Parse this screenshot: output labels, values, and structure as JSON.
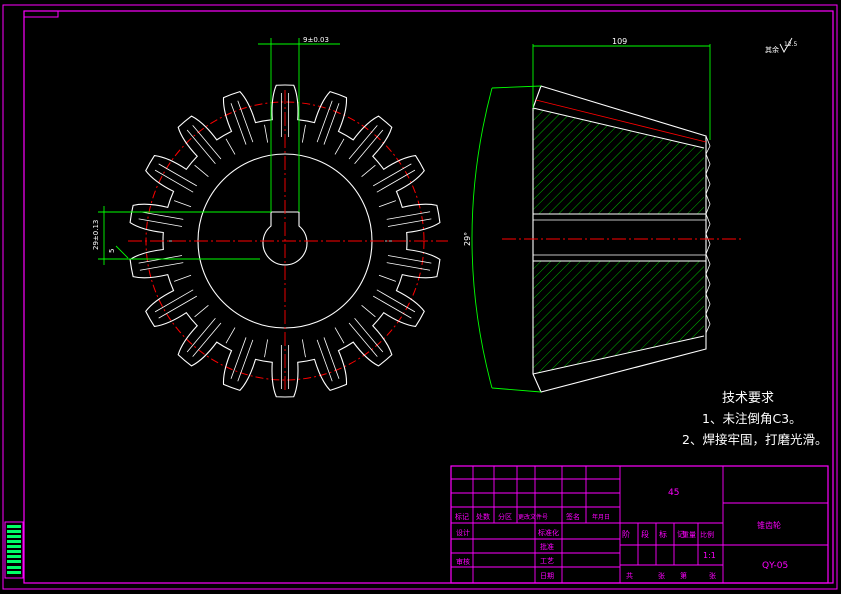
{
  "drawing": {
    "dimensions": {
      "keyway_width": "9±0.03",
      "keyway_depth": "29±0.13",
      "keyway_small": "5",
      "face_length": "109",
      "cone_angle": "29°",
      "surface_finish": "其余",
      "surface_finish_value": "12.5"
    },
    "notes": {
      "title": "技术要求",
      "items": [
        "1、未注倒角C3。",
        "2、焊接牢固，打磨光滑。"
      ]
    },
    "title_block": {
      "drawing_name": "锥齿轮",
      "material_mark": "45",
      "drawing_number": "QY-05",
      "scale": "1:1",
      "row_labels": [
        "标记",
        "处数",
        "分区",
        "更改文件号",
        "签名",
        "年月日"
      ],
      "left_labels": [
        "设计",
        "审核"
      ],
      "mid_labels": [
        "标准化",
        "批准",
        "工艺",
        "日期"
      ],
      "stage_labels": [
        "阶",
        "段",
        "标",
        "记",
        "重量",
        "比例"
      ],
      "sheet_labels": [
        "共",
        "张",
        "第",
        "张"
      ]
    }
  },
  "colors": {
    "frame": "#ff00ff",
    "outline": "#ffffff",
    "dimension": "#00ff00",
    "centerline": "#ff0000",
    "hatch": "#00ff00",
    "title_text": "#ff00ff"
  }
}
